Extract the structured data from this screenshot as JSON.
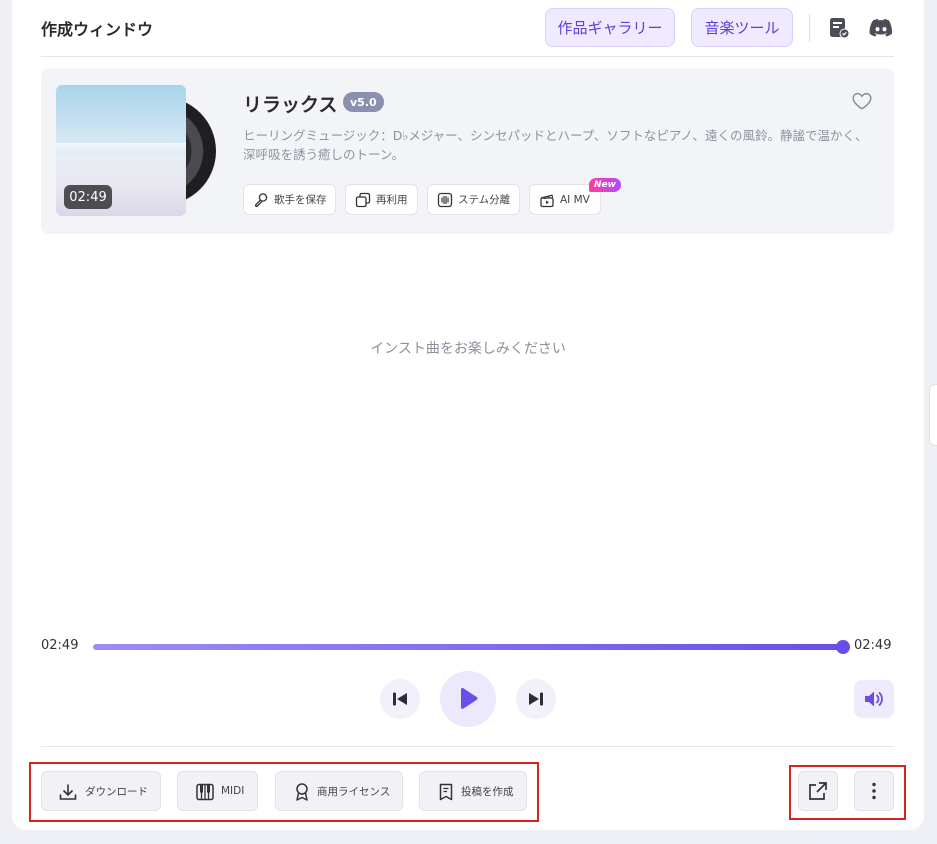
{
  "header": {
    "title": "作成ウィンドウ",
    "gallery_label": "作品ギャラリー",
    "tools_label": "音楽ツール"
  },
  "song": {
    "title": "リラックス",
    "version": "v5.0",
    "duration_badge": "02:49",
    "description": "ヒーリングミュージック：D♭メジャー、シンセパッドとハープ、ソフトなピアノ、遠くの風鈴。静謐で温かく、深呼吸を誘う癒しのトーン。",
    "chips": {
      "save_singer": "歌手を保存",
      "reuse": "再利用",
      "stem_split": "ステム分離",
      "ai_mv": "AI MV",
      "new_badge": "New"
    }
  },
  "empty_message": "インスト曲をお楽しみください",
  "player": {
    "current_time": "02:49",
    "total_time": "02:49",
    "progress": 1.0
  },
  "actions": {
    "download": "ダウンロード",
    "midi": "MIDI",
    "license": "商用ライセンス",
    "post": "投稿を作成"
  },
  "colors": {
    "accent": "#6a4ee8",
    "highlight": "#d9231f"
  }
}
